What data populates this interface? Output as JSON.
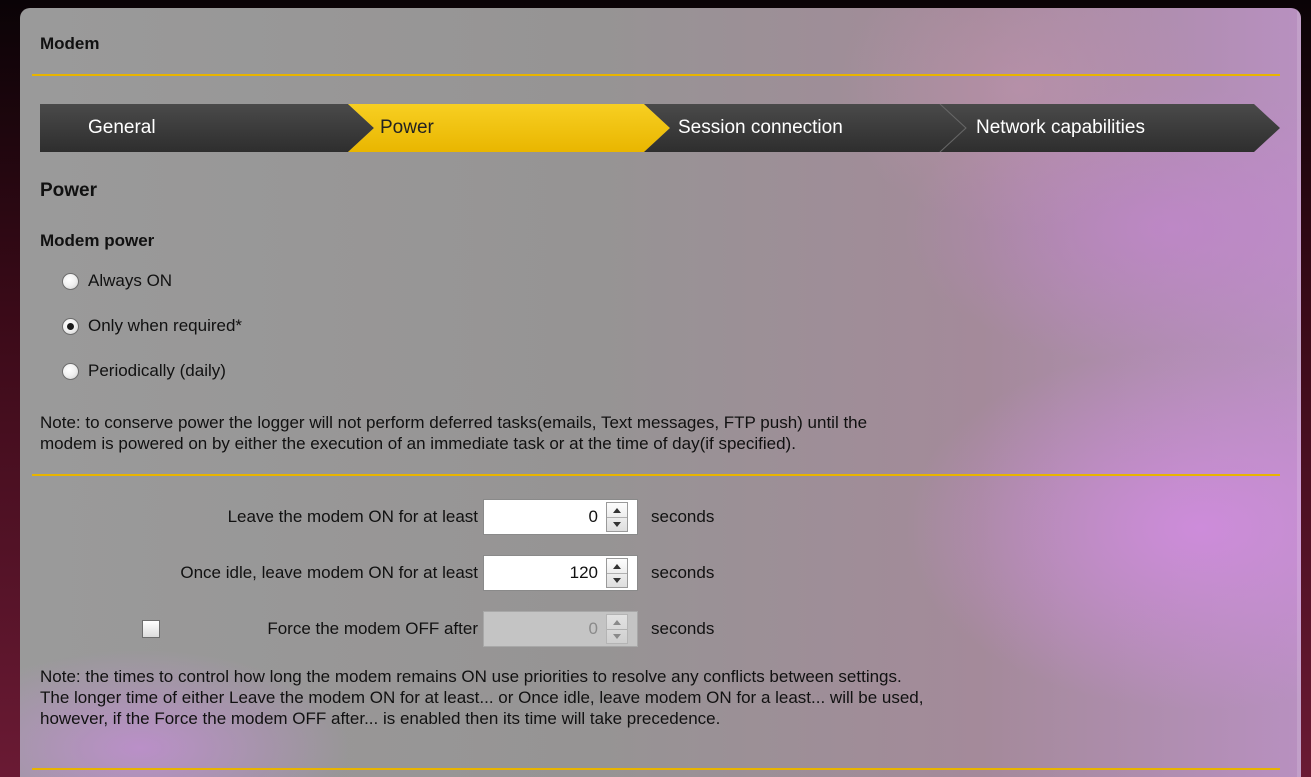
{
  "window": {
    "title": "Modem"
  },
  "wizard": {
    "steps": [
      {
        "label": "General",
        "active": false
      },
      {
        "label": "Power",
        "active": true
      },
      {
        "label": "Session connection",
        "active": false
      },
      {
        "label": "Network capabilities",
        "active": false
      }
    ],
    "colors": {
      "inactive": "#3b3b3b",
      "active": "#f2c200",
      "accent_rule": "#e8b400"
    }
  },
  "section": {
    "title": "Power"
  },
  "modem_power": {
    "title": "Modem power",
    "options": [
      {
        "label": "Always ON",
        "checked": false
      },
      {
        "label": "Only when required*",
        "checked": true
      },
      {
        "label": "Periodically (daily)",
        "checked": false
      }
    ]
  },
  "note1": {
    "line1": "Note: to conserve power the logger will not perform deferred tasks(emails, Text messages, FTP push) until the",
    "line2": "modem is powered on by either the execution of an immediate task or at the time of day(if specified)."
  },
  "timers": {
    "leave_on": {
      "label": "Leave the modem ON for at least",
      "value": "0",
      "unit": "seconds"
    },
    "idle_on": {
      "label": "Once idle, leave modem ON for at least",
      "value": "120",
      "unit": "seconds"
    },
    "force_off": {
      "label": "Force the modem OFF after",
      "value": "0",
      "unit": "seconds",
      "checked": false,
      "enabled": false
    }
  },
  "note2": {
    "line1": "Note: the times to control how long the modem remains ON use priorities to resolve any conflicts between settings.",
    "line2": "The longer time of either Leave the modem ON for at least... or Once idle, leave modem ON for a least... will be used,",
    "line3": "however, if the Force the modem OFF after... is enabled then its time will take precedence."
  },
  "icons": {
    "spin_up": "spin-up-arrow-icon",
    "spin_down": "spin-down-arrow-icon"
  }
}
